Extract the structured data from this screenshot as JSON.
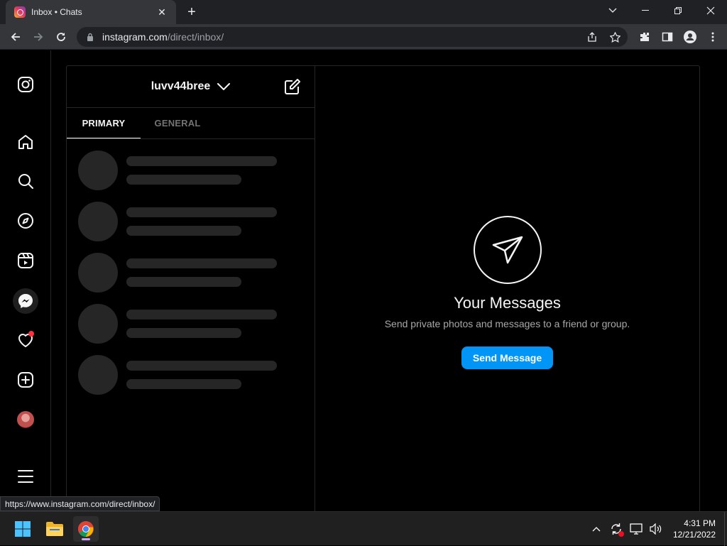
{
  "browser": {
    "tab_title": "Inbox • Chats",
    "url_host": "instagram.com",
    "url_path": "/direct/inbox/",
    "status_url": "https://www.instagram.com/direct/inbox/"
  },
  "dm": {
    "username": "luvv44bree",
    "tabs": [
      {
        "label": "PRIMARY",
        "active": true
      },
      {
        "label": "GENERAL",
        "active": false
      }
    ],
    "empty_title": "Your Messages",
    "empty_subtitle": "Send private photos and messages to a friend or group.",
    "send_button": "Send Message"
  },
  "nav": {
    "items": [
      "instagram-logo",
      "home-icon",
      "search-icon",
      "explore-icon",
      "reels-icon",
      "messenger-icon",
      "heart-icon",
      "create-icon",
      "profile-avatar",
      "menu-icon"
    ]
  },
  "taskbar": {
    "time": "4:31 PM",
    "date": "12/21/2022"
  },
  "colors": {
    "accent": "#0095f6",
    "notification": "#ff3040"
  }
}
